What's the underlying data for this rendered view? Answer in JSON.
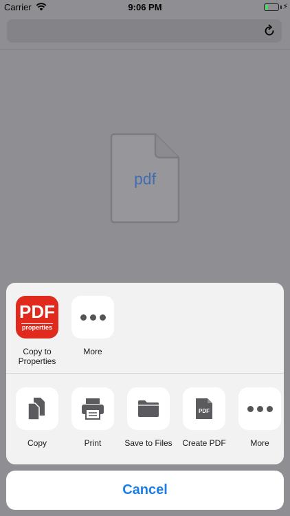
{
  "status_bar": {
    "carrier": "Carrier",
    "time": "9:06 PM",
    "battery_level": 0.24,
    "battery_color": "#4cd964"
  },
  "nav_bar": {
    "url_value": "",
    "reload_icon": "reload-icon"
  },
  "content": {
    "file_icon": "pdf-file-icon",
    "file_label": "pdf"
  },
  "share_sheet": {
    "apps": [
      {
        "icon": "pdf-properties-app-icon",
        "icon_text_main": "PDF",
        "icon_text_sub": "properties",
        "label": "Copy to Properties"
      },
      {
        "icon": "more-icon",
        "label": "More"
      }
    ],
    "actions": [
      {
        "icon": "copy-icon",
        "label": "Copy"
      },
      {
        "icon": "print-icon",
        "label": "Print"
      },
      {
        "icon": "folder-icon",
        "label": "Save to Files"
      },
      {
        "icon": "create-pdf-icon",
        "icon_text": "PDF",
        "label": "Create PDF"
      },
      {
        "icon": "more-icon",
        "label": "More"
      }
    ]
  },
  "cancel_label": "Cancel",
  "colors": {
    "accent": "#1a7fe8",
    "pdf_app_red": "#e02a1d",
    "dim_background": "#8e8e93"
  }
}
